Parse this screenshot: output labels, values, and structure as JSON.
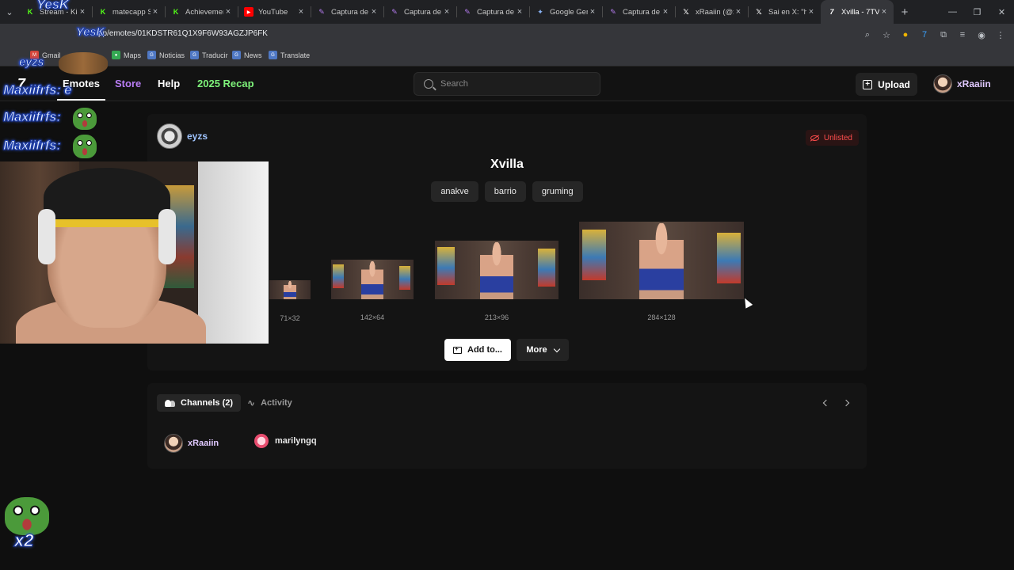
{
  "browser": {
    "tabs": [
      {
        "title": "Stream - Kick",
        "icon": "kick-icon",
        "color": "#53fc18"
      },
      {
        "title": "matecapp Stream",
        "icon": "kick-icon",
        "color": "#53fc18"
      },
      {
        "title": "Achievements",
        "icon": "kick-icon",
        "color": "#53fc18"
      },
      {
        "title": "YouTube",
        "icon": "youtube-icon",
        "color": "#ff0000"
      },
      {
        "title": "Captura de pantalla",
        "icon": "pen-icon",
        "color": "#b57cf0"
      },
      {
        "title": "Captura de pantalla",
        "icon": "pen-icon",
        "color": "#b57cf0"
      },
      {
        "title": "Captura de pantalla",
        "icon": "pen-icon",
        "color": "#b57cf0"
      },
      {
        "title": "Google Gemini",
        "icon": "gemini-icon",
        "color": "#8ab4f8"
      },
      {
        "title": "Captura de pantalla",
        "icon": "pen-icon",
        "color": "#b57cf0"
      },
      {
        "title": "xRaaiin (@xRaaiin)",
        "icon": "x-icon",
        "color": "#ffffff"
      },
      {
        "title": "Sai en X: \"he",
        "icon": "x-icon",
        "color": "#ffffff"
      },
      {
        "title": "Xvilla - 7TV",
        "icon": "7tv-icon",
        "color": "#ffffff",
        "active": true
      }
    ],
    "url": "pp/emotes/01KDSTR61Q1X9F6W93AGZJP6FK",
    "bookmarks": [
      "Gmail",
      "Maps",
      "Noticias",
      "Traducir",
      "News",
      "Translate"
    ]
  },
  "site": {
    "logo": "7",
    "nav": {
      "emotes": "Emotes",
      "store": "Store",
      "help": "Help",
      "recap": "2025 Recap"
    },
    "search_placeholder": "Search",
    "upload_label": "Upload",
    "username": "xRaaiin",
    "colors": {
      "store": "#b97df5",
      "recap": "#7ef27a",
      "unlisted": "#ff4d4d"
    }
  },
  "emote": {
    "owner": "eyzs",
    "status": "Unlisted",
    "name": "Xvilla",
    "tags": [
      "anakve",
      "barrio",
      "gruming"
    ],
    "sizes": [
      "71×32",
      "142×64",
      "213×96",
      "284×128"
    ],
    "add_label": "Add to...",
    "more_label": "More"
  },
  "panel": {
    "channels_tab": "Channels (2)",
    "activity_tab": "Activity",
    "channels": [
      "xRaaiin",
      "marilyngq"
    ]
  },
  "overlay": {
    "chat": [
      {
        "user": "YesK",
        "text": ""
      },
      {
        "user": "eyzs",
        "text": ""
      },
      {
        "user": "Maxiifrfs",
        "text": "e"
      },
      {
        "user": "Maxiifrfs",
        "text": ""
      },
      {
        "user": "Maxiifrfs",
        "text": ""
      }
    ],
    "multiplier": "x2"
  }
}
